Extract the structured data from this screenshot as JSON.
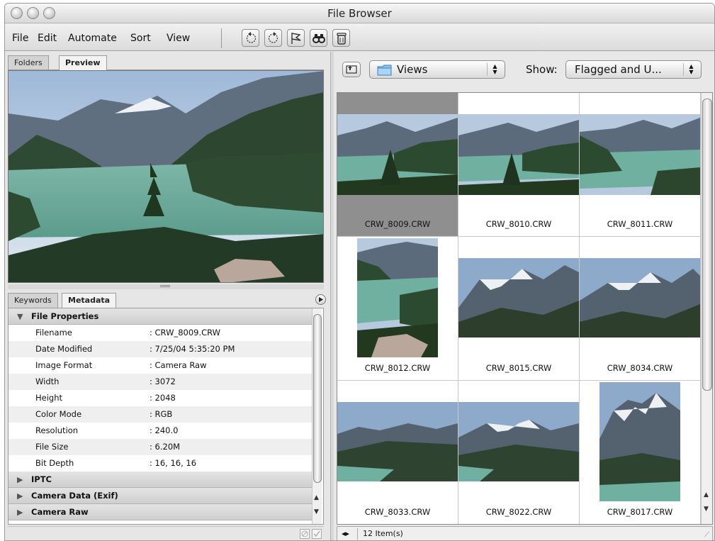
{
  "window": {
    "title": "File Browser"
  },
  "menu": [
    "File",
    "Edit",
    "Automate",
    "Sort",
    "View"
  ],
  "left_tabs": {
    "folders": "Folders",
    "preview": "Preview"
  },
  "meta_tabs": {
    "keywords": "Keywords",
    "metadata": "Metadata"
  },
  "metadata": {
    "file_properties": "File Properties",
    "rows": [
      {
        "key": "Filename",
        "value": ": CRW_8009.CRW"
      },
      {
        "key": "Date Modified",
        "value": ": 7/25/04 5:35:20 PM"
      },
      {
        "key": "Image Format",
        "value": ": Camera Raw"
      },
      {
        "key": "Width",
        "value": ": 3072"
      },
      {
        "key": "Height",
        "value": ": 2048"
      },
      {
        "key": "Color Mode",
        "value": ": RGB"
      },
      {
        "key": "Resolution",
        "value": ": 240.0"
      },
      {
        "key": "File Size",
        "value": ": 6.20M"
      },
      {
        "key": "Bit Depth",
        "value": ": 16, 16, 16"
      }
    ],
    "sections": [
      "IPTC",
      "Camera Data (Exif)",
      "Camera Raw"
    ]
  },
  "location": {
    "folder": "Views",
    "show_label": "Show:",
    "show_value": "Flagged and U..."
  },
  "files": [
    {
      "name": "CRW_8009.CRW",
      "selected": true
    },
    {
      "name": "CRW_8010.CRW"
    },
    {
      "name": "CRW_8011.CRW"
    },
    {
      "name": "CRW_8012.CRW"
    },
    {
      "name": "CRW_8015.CRW"
    },
    {
      "name": "CRW_8034.CRW"
    },
    {
      "name": "CRW_8033.CRW"
    },
    {
      "name": "CRW_8022.CRW"
    },
    {
      "name": "CRW_8017.CRW"
    }
  ],
  "status": {
    "count": "12 Item(s)"
  }
}
